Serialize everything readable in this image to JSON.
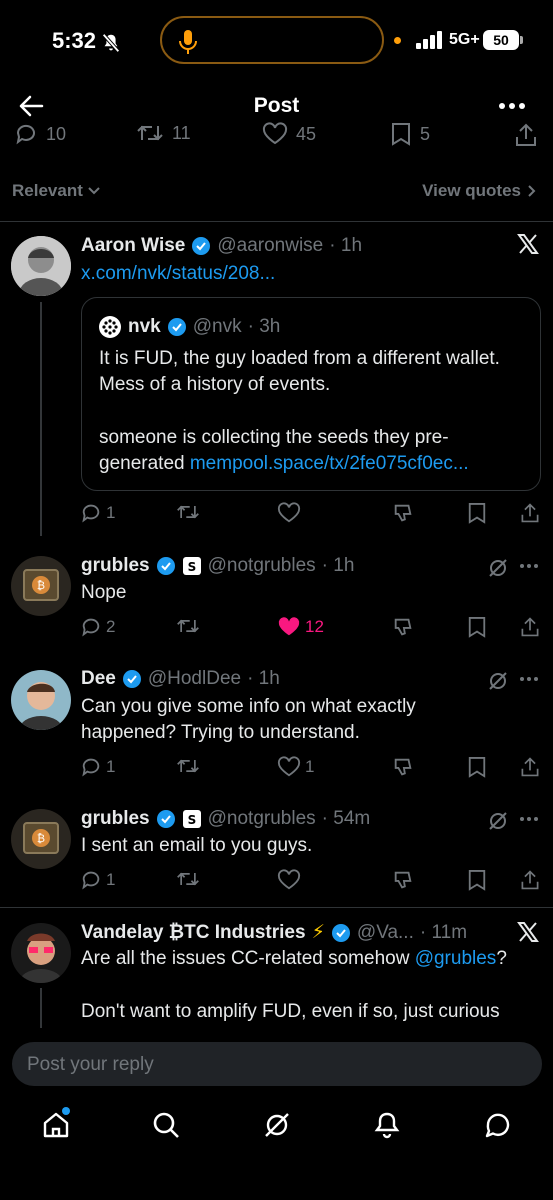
{
  "status_bar": {
    "time": "5:32",
    "network": "5G+",
    "battery": "50"
  },
  "header": {
    "title": "Post"
  },
  "engagement": {
    "replies": "10",
    "reposts": "11",
    "likes": "45",
    "bookmarks": "5"
  },
  "sort": {
    "label": "Relevant",
    "view_quotes": "View quotes"
  },
  "post": {
    "name": "Aaron Wise",
    "handle": "@aaronwise",
    "time": "· 1h",
    "link": "x.com/nvk/status/208...",
    "quote": {
      "name": "nvk",
      "handle": "@nvk",
      "time": "· 3h",
      "text_1": "It is FUD, the guy loaded from a different wallet.",
      "text_2": "Mess of a history of events.",
      "text_3": "someone is collecting the seeds they pre-",
      "text_4_prefix": "generated ",
      "text_4_link": "mempool.space/tx/2fe075cf0ec..."
    },
    "replies": "1"
  },
  "replies": [
    {
      "name": "grubles",
      "handle": "@notgrubles",
      "time": "· 1h",
      "text": "Nope",
      "replies": "2",
      "likes": "12"
    },
    {
      "name": "Dee",
      "handle": "@HodlDee",
      "time": "· 1h",
      "text_1": "Can you give some info on what exactly",
      "text_2": "happened? Trying to understand.",
      "replies": "1",
      "likes": "1"
    },
    {
      "name": "grubles",
      "handle": "@notgrubles",
      "time": "· 54m",
      "text": "I sent an email to you guys.",
      "replies": "1"
    },
    {
      "name": "Vandelay ₿TC Industries",
      "emoji": "⚡",
      "handle": "@Va...",
      "time": "· 11m",
      "text_1_prefix": "Are all the issues CC-related somehow ",
      "text_1_mention": "@grubles",
      "text_1_suffix": "?",
      "text_2": "Don't want to amplify FUD, even if so,  just curious"
    }
  ],
  "reply_bar": {
    "placeholder": "Post your reply"
  },
  "colors": {
    "background": "#000000",
    "accent": "#1d9bf0",
    "like": "#f91880",
    "muted": "#71767b"
  }
}
